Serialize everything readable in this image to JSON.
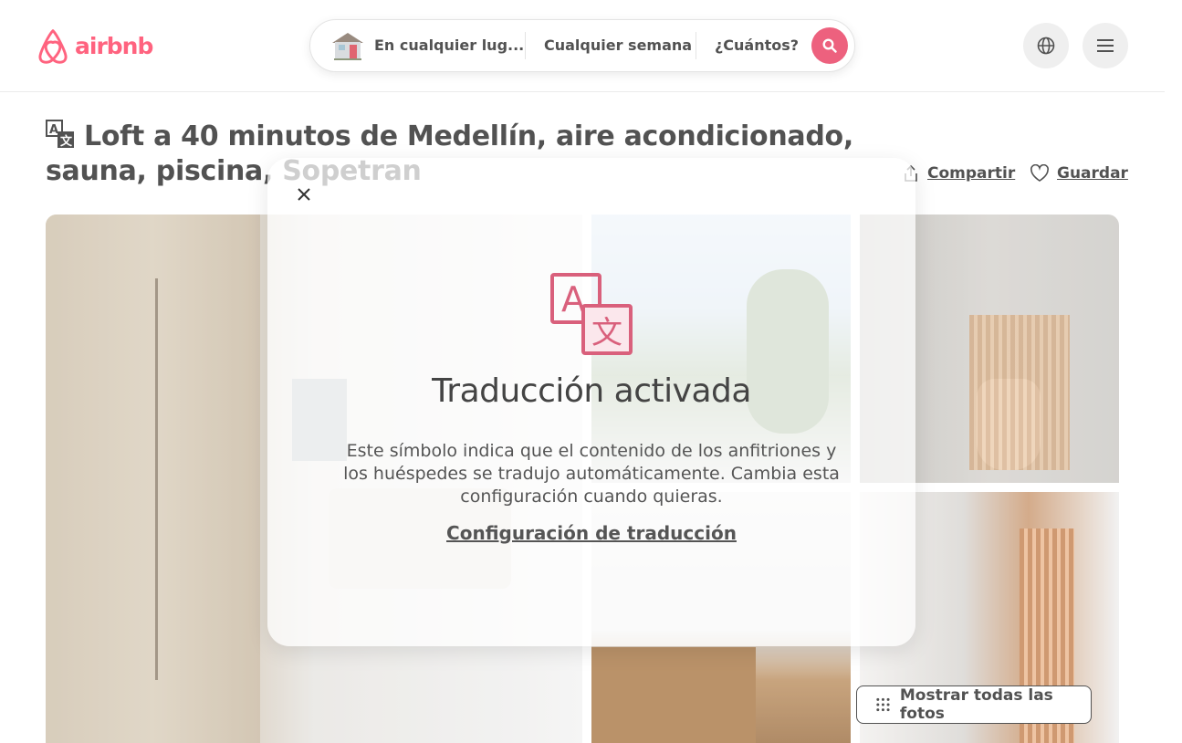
{
  "header": {
    "logo_text": "airbnb",
    "search": {
      "where": "En cualquier lug...",
      "when": "Cualquier semana",
      "who": "¿Cuántos?"
    }
  },
  "listing": {
    "title": "Loft a 40 minutos de Medellín, aire acondicionado, sauna, piscina, Sopetran",
    "share_label": "Compartir",
    "save_label": "Guardar",
    "show_all_photos": "Mostrar todas las fotos"
  },
  "modal": {
    "title": "Traducción activada",
    "body": "Este símbolo indica que el contenido de los anfitriones y los huéspedes se tradujo automáticamente. Cambia esta configuración cuando quieras.",
    "link": "Configuración de traducción"
  },
  "colors": {
    "brand": "#ff385c",
    "search_button": "#e8355a",
    "text": "#222222"
  }
}
